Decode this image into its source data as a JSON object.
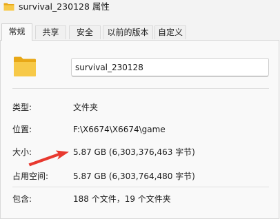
{
  "window": {
    "title": "survival_230128 属性"
  },
  "tabs": [
    {
      "label": "常规",
      "active": true
    },
    {
      "label": "共享",
      "active": false
    },
    {
      "label": "安全",
      "active": false
    },
    {
      "label": "以前的版本",
      "active": false
    },
    {
      "label": "自定义",
      "active": false
    }
  ],
  "general": {
    "name": "survival_230128",
    "type_label": "类型:",
    "type_value": "文件夹",
    "location_label": "位置:",
    "location_value": "F:\\X6674\\X6674\\game",
    "size_label": "大小:",
    "size_value": "5.87 GB (6,303,376,463 字节)",
    "size_on_disk_label": "占用空间:",
    "size_on_disk_value": "5.87 GB (6,303,764,480 字节)",
    "contains_label": "包含:",
    "contains_value": "188 个文件，19 个文件夹"
  },
  "colors": {
    "folder": "#f5c242",
    "folder_dark": "#e8a817",
    "annotation_arrow": "#e8392f"
  },
  "icons": {
    "title": "folder-icon",
    "large": "folder-icon",
    "annotation": "red-arrow"
  }
}
